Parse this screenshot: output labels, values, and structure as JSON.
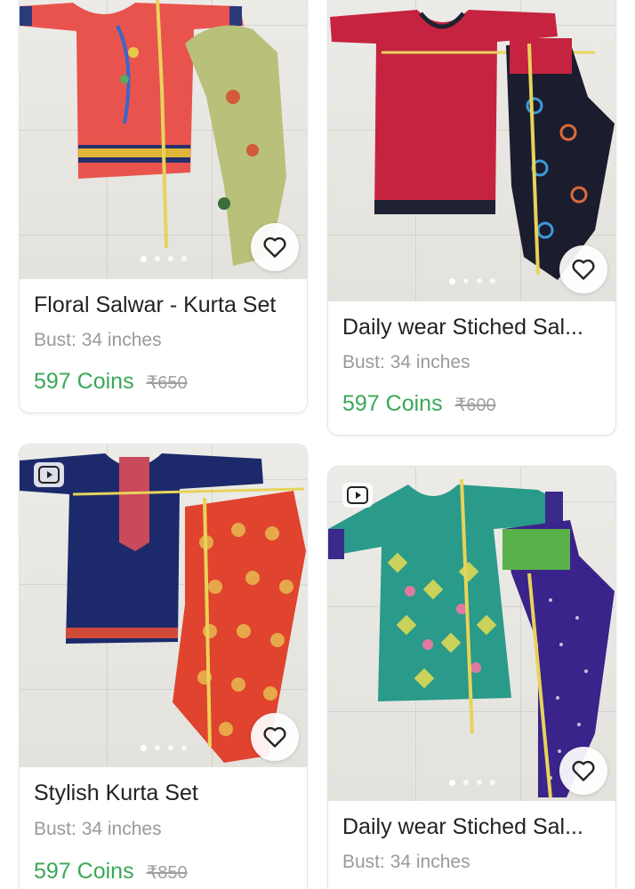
{
  "theme": {
    "coin_color": "#3aa757",
    "title_color": "#222222",
    "muted_color": "#9a9a9a"
  },
  "products": [
    {
      "title": "Floral Salwar - Kurta Set",
      "subtitle": "Bust: 34 inches",
      "price": "597 Coins",
      "mrp": "₹650",
      "image_slides": 4,
      "active_slide": 1,
      "has_video": false,
      "icons": {
        "favorite": "heart-outline-icon"
      }
    },
    {
      "title": "Daily wear Stiched Sal...",
      "subtitle": "Bust: 34 inches",
      "price": "597 Coins",
      "mrp": "₹600",
      "image_slides": 4,
      "active_slide": 1,
      "has_video": false,
      "icons": {
        "favorite": "heart-outline-icon"
      }
    },
    {
      "title": "Stylish Kurta Set",
      "subtitle": "Bust: 34 inches",
      "price": "597 Coins",
      "mrp": "₹850",
      "image_slides": 4,
      "active_slide": 1,
      "has_video": true,
      "icons": {
        "favorite": "heart-outline-icon",
        "video": "video-play-icon"
      }
    },
    {
      "title": "Daily wear Stiched Sal...",
      "subtitle": "Bust: 34 inches",
      "price": "",
      "mrp": "",
      "image_slides": 4,
      "active_slide": 1,
      "has_video": true,
      "icons": {
        "favorite": "heart-outline-icon",
        "video": "video-play-icon"
      }
    }
  ]
}
